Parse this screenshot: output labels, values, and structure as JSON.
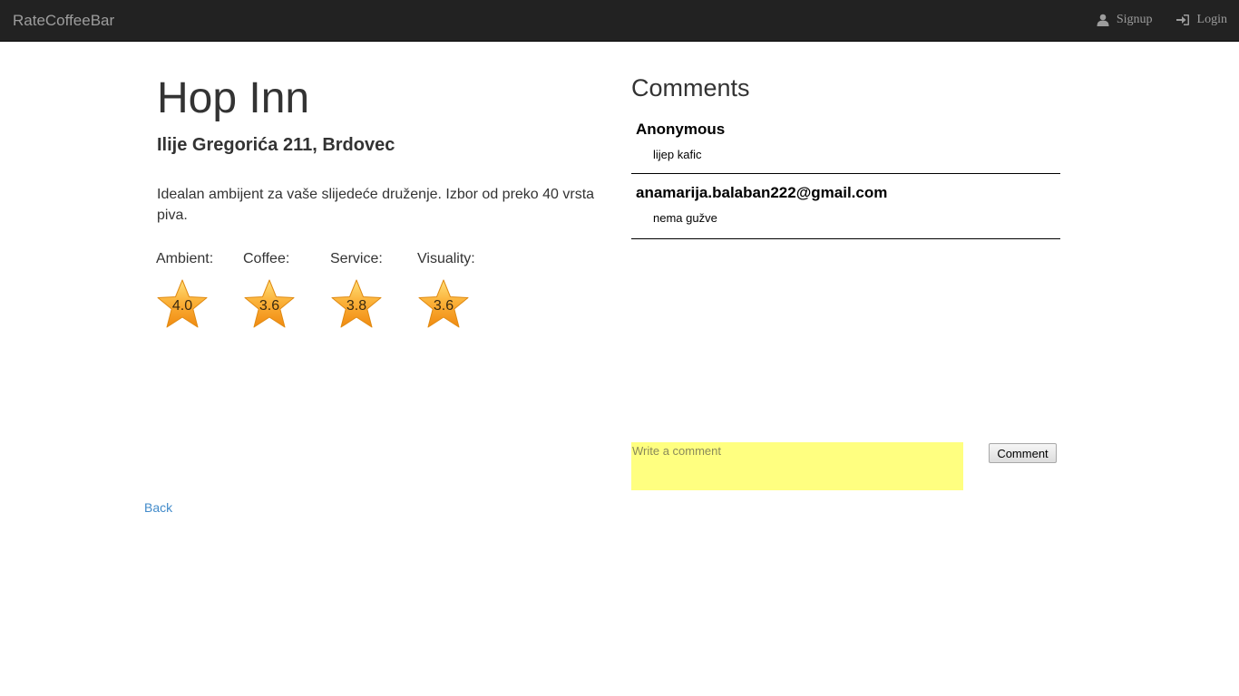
{
  "navbar": {
    "brand": "RateCoffeeBar",
    "signup_label": "Signup",
    "login_label": "Login"
  },
  "place": {
    "name": "Hop Inn",
    "address": "Ilije Gregorića 211, Brdovec",
    "description": "Idealan ambijent za vaše slijedeće druženje. Izbor od preko 40 vrsta piva."
  },
  "ratings": [
    {
      "label": "Ambient:",
      "value": "4.0"
    },
    {
      "label": "Coffee:",
      "value": "3.6"
    },
    {
      "label": "Service:",
      "value": "3.8"
    },
    {
      "label": "Visuality:",
      "value": "3.6"
    }
  ],
  "comments": {
    "title": "Comments",
    "items": [
      {
        "author": "Anonymous",
        "text": "lijep kafic"
      },
      {
        "author": "anamarija.balaban222@gmail.com",
        "text": "nema gužve"
      }
    ],
    "input_placeholder": "Write a comment",
    "submit_label": "Comment"
  },
  "back_label": "Back",
  "icons": {
    "signup": "user-icon",
    "login": "log-in-icon",
    "rating": "star-icon"
  },
  "colors": {
    "navbar_bg": "#222222",
    "link": "#428bca",
    "comment_input_bg": "#ffff80",
    "star": "#f7a21b"
  }
}
